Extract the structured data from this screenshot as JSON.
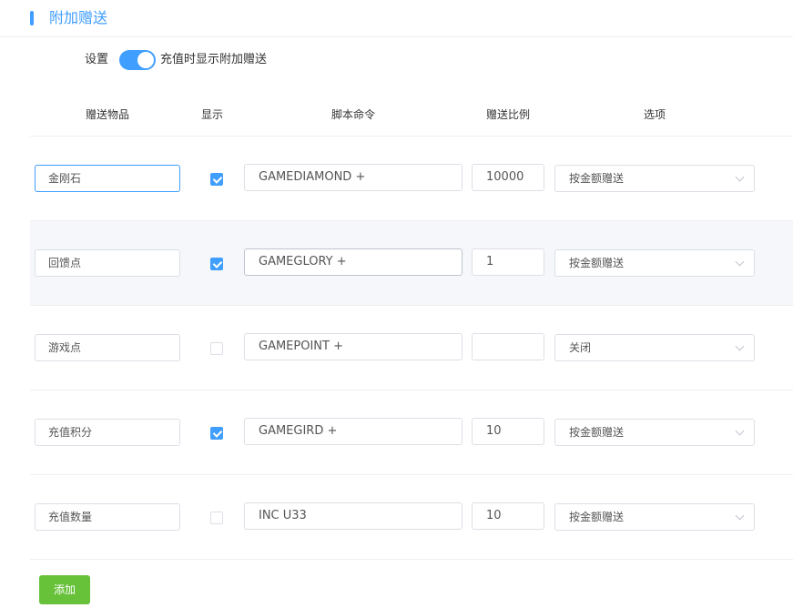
{
  "section": {
    "title": "附加赠送"
  },
  "setting": {
    "label": "设置",
    "toggle_on": true,
    "toggle_text": "充值时显示附加赠送"
  },
  "columns": [
    "赠送物品",
    "显示",
    "脚本命令",
    "赠送比例",
    "选项"
  ],
  "rows": [
    {
      "item": "金刚石",
      "show": true,
      "command": "GAMEDIAMOND +",
      "ratio": "10000",
      "option": "按金额赠送"
    },
    {
      "item": "回馈点",
      "show": true,
      "command": "GAMEGLORY +",
      "ratio": "1",
      "option": "按金额赠送"
    },
    {
      "item": "游戏点",
      "show": false,
      "command": "GAMEPOINT +",
      "ratio": "",
      "option": "关闭"
    },
    {
      "item": "充值积分",
      "show": true,
      "command": "GAMEGIRD +",
      "ratio": "10",
      "option": "按金额赠送"
    },
    {
      "item": "充值数量",
      "show": false,
      "command": "INC U33",
      "ratio": "10",
      "option": "按金额赠送"
    }
  ],
  "add_button": {
    "label": "添加"
  },
  "colors": {
    "accent": "#409eff",
    "success": "#67c23a",
    "border": "#dcdfe6"
  },
  "icons": {
    "select_arrow": "chevron-down-icon",
    "checkbox_mark": "check-icon"
  }
}
